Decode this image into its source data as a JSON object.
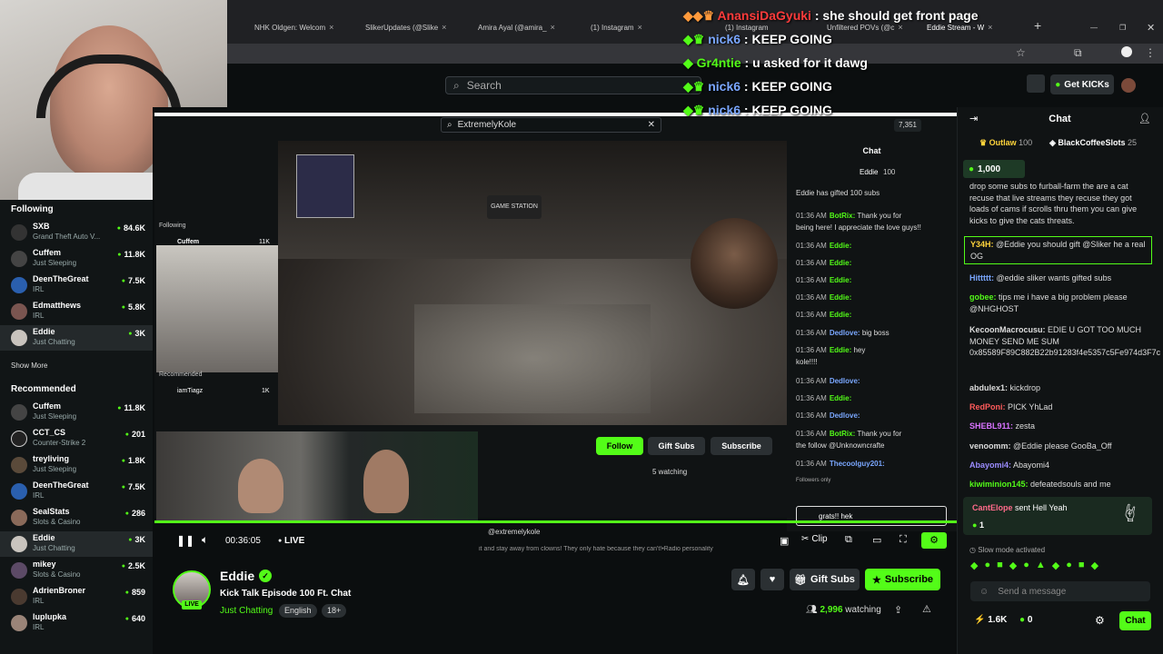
{
  "browser": {
    "tabs": [
      {
        "label": "NHK Oldgen: Welcom"
      },
      {
        "label": "SlikerUpdates (@Slike"
      },
      {
        "label": "Amira Ayal (@amira_"
      },
      {
        "label": "(1) Instagram"
      },
      {
        "label": "(1) Instagram"
      },
      {
        "label": "Unfiltered POVs (@c"
      },
      {
        "label": "Eddie Stream - W"
      }
    ]
  },
  "kick": {
    "search_placeholder": "Search",
    "get_kicks": "Get KICKs"
  },
  "overlay_chat": [
    {
      "user": "AnansiDaGyuki",
      "msg": " : she should get front page",
      "color": "#ff3b3b"
    },
    {
      "user": "nick6",
      "msg": " : KEEP GOING",
      "color": "#7aa7ff"
    },
    {
      "user": "Gr4ntie",
      "msg": " : u asked for it dawg",
      "color": "#53fc18"
    },
    {
      "user": "nick6",
      "msg": " : KEEP GOING",
      "color": "#7aa7ff"
    },
    {
      "user": "nick6",
      "msg": " : KEEP GOING",
      "color": "#7aa7ff"
    }
  ],
  "sidebar": {
    "following_title": "Following",
    "following": [
      {
        "name": "SXB",
        "sub": "Grand Theft Auto V...",
        "count": "84.6K"
      },
      {
        "name": "Cuffem",
        "sub": "Just Sleeping",
        "count": "11.8K"
      },
      {
        "name": "DeenTheGreat",
        "sub": "IRL",
        "count": "7.5K"
      },
      {
        "name": "Edmatthews",
        "sub": "IRL",
        "count": "5.8K"
      },
      {
        "name": "Eddie",
        "sub": "Just Chatting",
        "count": "3K"
      }
    ],
    "show_more": "Show More",
    "recommended_title": "Recommended",
    "recommended": [
      {
        "name": "Cuffem",
        "sub": "Just Sleeping",
        "count": "11.8K"
      },
      {
        "name": "CCT_CS",
        "sub": "Counter-Strike 2",
        "count": "201"
      },
      {
        "name": "treyliving",
        "sub": "Just Sleeping",
        "count": "1.8K"
      },
      {
        "name": "DeenTheGreat",
        "sub": "IRL",
        "count": "7.5K"
      },
      {
        "name": "SealStats",
        "sub": "Slots & Casino",
        "count": "286"
      },
      {
        "name": "Eddie",
        "sub": "Just Chatting",
        "count": "3K"
      },
      {
        "name": "mikey",
        "sub": "Slots & Casino",
        "count": "2.5K"
      },
      {
        "name": "AdrienBroner",
        "sub": "IRL",
        "count": "859"
      },
      {
        "name": "luplupka",
        "sub": "IRL",
        "count": "640"
      }
    ]
  },
  "inner_page": {
    "search_value": "ExtremelyKole",
    "viewers": "7,351",
    "chat_title": "Chat",
    "following": "Following",
    "recommended": "Recommended",
    "cuffem": "Cuffem",
    "cuffem_count": "11K",
    "iamtiagz": "iamTiagz",
    "iamtiagz_count": "1K",
    "follow": "Follow",
    "gift_subs": "Gift Subs",
    "subscribe": "Subscribe",
    "watching": "5 watching",
    "handle": "@extremelykole",
    "bio": "it and stay away from clowns! They only hate because they can't!•Radio personality",
    "leader": "Eddie",
    "leader_count": "100",
    "gifted": "Eddie has gifted 100 subs",
    "input_value": "grats!! hek",
    "followers_only": "Followers only",
    "chat": [
      {
        "time": "01:36 AM",
        "user": "BotRix:",
        "msg": " Thank you for",
        "cls": ""
      },
      {
        "time": "",
        "user": "",
        "msg": "being here! I appreciate the love guys!!",
        "cls": ""
      },
      {
        "time": "01:36 AM",
        "user": "Eddie:",
        "msg": "",
        "cls": ""
      },
      {
        "time": "01:36 AM",
        "user": "Eddie:",
        "msg": "",
        "cls": ""
      },
      {
        "time": "01:36 AM",
        "user": "Eddie:",
        "msg": "",
        "cls": ""
      },
      {
        "time": "01:36 AM",
        "user": "Eddie:",
        "msg": "",
        "cls": ""
      },
      {
        "time": "01:36 AM",
        "user": "Eddie:",
        "msg": "",
        "cls": ""
      },
      {
        "time": "01:36 AM",
        "user": "Dedlove:",
        "msg": " big boss",
        "cls": "red"
      },
      {
        "time": "01:36 AM",
        "user": "Eddie:",
        "msg": " hey",
        "cls": ""
      },
      {
        "time": "",
        "user": "",
        "msg": "kole!!!!",
        "cls": ""
      },
      {
        "time": "01:36 AM",
        "user": "Dedlove:",
        "msg": "",
        "cls": "red"
      },
      {
        "time": "01:36 AM",
        "user": "Eddie:",
        "msg": "",
        "cls": ""
      },
      {
        "time": "01:36 AM",
        "user": "Dedlove:",
        "msg": "",
        "cls": "red"
      },
      {
        "time": "01:36 AM",
        "user": "BotRix:",
        "msg": " Thank you for",
        "cls": ""
      },
      {
        "time": "",
        "user": "",
        "msg": "the follow @Unknowncrafte",
        "cls": ""
      },
      {
        "time": "01:36 AM",
        "user": "Thecoolguy201:",
        "msg": "",
        "cls": "red"
      }
    ]
  },
  "player": {
    "time": "00:36:05",
    "live": "LIVE",
    "clip": "Clip"
  },
  "channel": {
    "name": "Eddie",
    "title": "Kick Talk Episode 100 Ft. Chat",
    "category": "Just Chatting",
    "tags": [
      "English",
      "18+"
    ],
    "live_badge": "LIVE",
    "gift_subs": "Gift Subs",
    "subscribe": "Subscribe",
    "watching_count": "2,996",
    "watching_label": " watching"
  },
  "chat": {
    "title": "Chat",
    "pinned": [
      {
        "user": "Outlaw",
        "count": "100"
      },
      {
        "user": "BlackCoffeeSlots",
        "count": "25"
      }
    ],
    "kicks": "1,000",
    "messages": [
      {
        "user": "",
        "msg": "drop some subs to furball-farm the are a cat recuse that live streams they recuse they got loads of cams if scrolls thru them you can give kicks to give the cats threats.",
        "color": "#ddd"
      },
      {
        "user": "Y34H:",
        "msg": " @Eddie you should gift @Sliker he a real OG",
        "color": "#ffd43b"
      },
      {
        "user": "Hittttt:",
        "msg": " @eddie sliker wants gifted subs",
        "color": "#7aa7ff"
      },
      {
        "user": "gobee:",
        "msg": " tips me i have a big problem please @NHGHOST",
        "color": "#53fc18"
      },
      {
        "user": "KecoonMacrocusu:",
        "msg": " EDIE U GOT TOO MUCH MONEY SEND ME SUM 0x85589F89C882B22b91283f4e5357c5Fe974d3F7c",
        "color": "#ddd"
      },
      {
        "user": "abdulex1:",
        "msg": " kickdrop",
        "color": "#ddd"
      },
      {
        "user": "RedPoni:",
        "msg": " PICK YhLad",
        "color": "#ff5b5b"
      },
      {
        "user": "SHEBL911:",
        "msg": " zesta",
        "color": "#d873ff"
      },
      {
        "user": "venoomm:",
        "msg": " @Eddie please GooBa_Off",
        "color": "#ddd"
      },
      {
        "user": "Abayomi4:",
        "msg": " Abayomi4",
        "color": "#9b8cff"
      },
      {
        "user": "kiwiminion145:",
        "msg": " defeatedsouls and me",
        "color": "#53fc18"
      }
    ],
    "gift_user": "CantElope",
    "gift_msg": " sent Hell Yeah",
    "gift_count": "1",
    "slow_mode": "Slow mode activated",
    "send_placeholder": "Send a message",
    "kick_balance": "1.6K",
    "zero": "0",
    "chat_button": "Chat"
  }
}
